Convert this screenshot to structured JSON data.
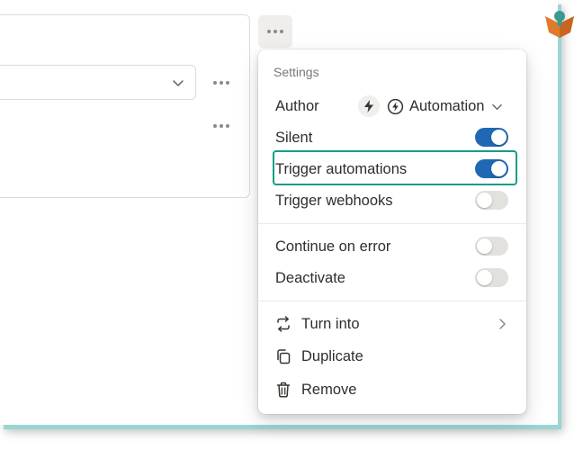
{
  "menu": {
    "title": "Settings",
    "author": {
      "label": "Author",
      "value": "Automation",
      "icon": "bolt-icon"
    },
    "toggles": [
      {
        "label": "Silent",
        "on": true
      },
      {
        "label": "Trigger automations",
        "on": true,
        "highlighted": true
      },
      {
        "label": "Trigger webhooks",
        "on": false
      },
      {
        "label": "Continue on error",
        "on": false
      },
      {
        "label": "Deactivate",
        "on": false
      }
    ],
    "actions": [
      {
        "label": "Turn into",
        "icon": "turn-into-icon",
        "submenu": true
      },
      {
        "label": "Duplicate",
        "icon": "duplicate-icon"
      },
      {
        "label": "Remove",
        "icon": "trash-icon"
      }
    ]
  },
  "colors": {
    "toggle_on": "#2068b4",
    "toggle_off": "#e2e1de",
    "highlight_border": "#169c86",
    "frame_shadow": "#9ad5d3"
  }
}
